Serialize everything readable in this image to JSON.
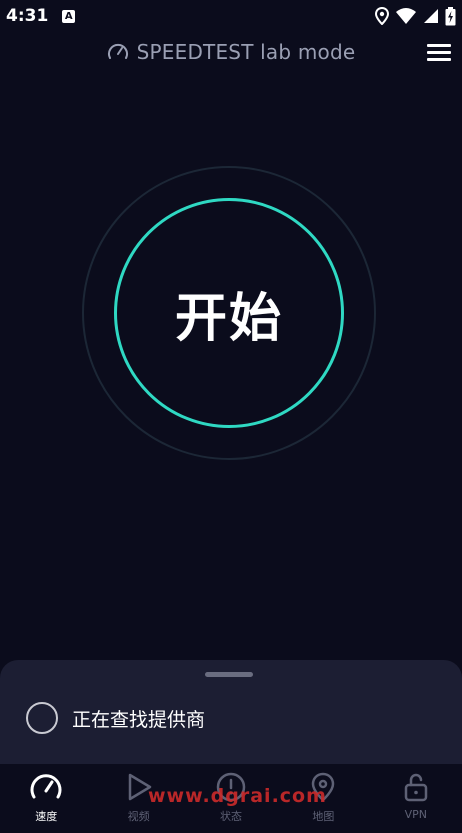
{
  "status_bar": {
    "time": "4:31",
    "notification_glyph": "A"
  },
  "header": {
    "title": "SPEEDTEST lab mode"
  },
  "main": {
    "start_label": "开始"
  },
  "sheet": {
    "provider_status": "正在查找提供商"
  },
  "nav": {
    "items": [
      {
        "label": "速度",
        "icon": "speedometer-icon"
      },
      {
        "label": "视频",
        "icon": "play-icon"
      },
      {
        "label": "状态",
        "icon": "alert-circle-icon"
      },
      {
        "label": "地图",
        "icon": "map-pin-icon"
      },
      {
        "label": "VPN",
        "icon": "unlock-icon"
      }
    ]
  },
  "watermark": "www.dgrai.com",
  "colors": {
    "background": "#0b0c1c",
    "accent": "#2fd9c3",
    "sheet": "#1c1e33",
    "muted": "#5e6175"
  }
}
